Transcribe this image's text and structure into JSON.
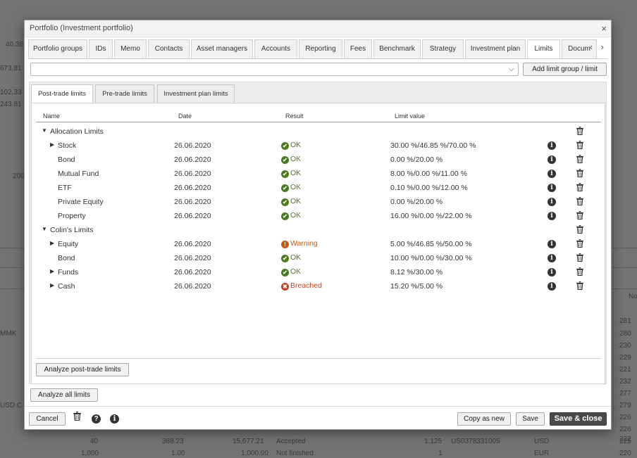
{
  "background": {
    "left_labels": [
      "40.36",
      "673.81",
      "102.33",
      "243.81",
      "200",
      "MMK",
      "USD C"
    ],
    "right_labels": [
      "No",
      "281",
      "280",
      "230",
      "229",
      "221",
      "232",
      "277",
      "279",
      "226",
      "226",
      "222",
      "225",
      "220",
      "221"
    ],
    "bottom_rows": [
      [
        "40",
        "388.23",
        "15,677.21",
        "Accepted",
        "1.125",
        "US0378331005",
        "USD"
      ],
      [
        "1,000",
        "1.00",
        "1,000.00",
        "Not finished",
        "1",
        "",
        "EUR"
      ]
    ]
  },
  "modal": {
    "title": "Portfolio (Investment portfolio)",
    "close_glyph": "×"
  },
  "tabs": [
    {
      "label": "Portfolio groups"
    },
    {
      "label": "IDs"
    },
    {
      "label": "Memo"
    },
    {
      "label": "Contacts"
    },
    {
      "label": "Asset managers"
    },
    {
      "label": "Accounts"
    },
    {
      "label": "Reporting"
    },
    {
      "label": "Fees"
    },
    {
      "label": "Benchmark"
    },
    {
      "label": "Strategy"
    },
    {
      "label": "Investment plan"
    },
    {
      "label": "Limits"
    },
    {
      "label": "Docum"
    }
  ],
  "active_tab": "Limits",
  "tab_arrows": "‹ ›",
  "group_select": {
    "value": "",
    "chevron": "⌵"
  },
  "add_limit_button": "Add limit group / limit",
  "subtabs": [
    {
      "label": "Post-trade limits"
    },
    {
      "label": "Pre-trade limits"
    },
    {
      "label": "Investment plan limits"
    }
  ],
  "columns": {
    "name": "Name",
    "date": "Date",
    "result": "Result",
    "limit_value": "Limit value"
  },
  "rows": [
    {
      "level": 0,
      "expand": "▼",
      "name": "Allocation Limits",
      "date": "",
      "result": "",
      "status": "",
      "icon": "",
      "limit": "",
      "info": false
    },
    {
      "level": 1,
      "expand": "▶",
      "name": "Stock",
      "date": "26.06.2020",
      "result": "OK",
      "status": "ok",
      "icon": "✔",
      "limit": "30.00 %/46.85 %/70.00 %",
      "info": true
    },
    {
      "level": 1,
      "expand": "",
      "name": "Bond",
      "date": "26.06.2020",
      "result": "OK",
      "status": "ok",
      "icon": "✔",
      "limit": "0.00 %/20.00 %",
      "info": true
    },
    {
      "level": 1,
      "expand": "",
      "name": "Mutual Fund",
      "date": "26.06.2020",
      "result": "OK",
      "status": "ok",
      "icon": "✔",
      "limit": "8.00 %/0.00 %/11.00 %",
      "info": true
    },
    {
      "level": 1,
      "expand": "",
      "name": "ETF",
      "date": "26.06.2020",
      "result": "OK",
      "status": "ok",
      "icon": "✔",
      "limit": "0.10 %/0.00 %/12.00 %",
      "info": true
    },
    {
      "level": 1,
      "expand": "",
      "name": "Private Equity",
      "date": "26.06.2020",
      "result": "OK",
      "status": "ok",
      "icon": "✔",
      "limit": "0.00 %/20.00 %",
      "info": true
    },
    {
      "level": 1,
      "expand": "",
      "name": "Property",
      "date": "26.06.2020",
      "result": "OK",
      "status": "ok",
      "icon": "✔",
      "limit": "16.00 %/0.00 %/22.00 %",
      "info": true
    },
    {
      "level": 0,
      "expand": "▼",
      "name": "Colin's Limits",
      "date": "",
      "result": "",
      "status": "",
      "icon": "",
      "limit": "",
      "info": false
    },
    {
      "level": 1,
      "expand": "▶",
      "name": "Equity",
      "date": "26.06.2020",
      "result": "Warning",
      "status": "warn",
      "icon": "!",
      "limit": "5.00 %/46.85 %/50.00 %",
      "info": true
    },
    {
      "level": 1,
      "expand": "",
      "name": "Bond",
      "date": "26.06.2020",
      "result": "OK",
      "status": "ok",
      "icon": "✔",
      "limit": "10.00 %/0.00 %/30.00 %",
      "info": true
    },
    {
      "level": 1,
      "expand": "▶",
      "name": "Funds",
      "date": "26.06.2020",
      "result": "OK",
      "status": "ok",
      "icon": "✔",
      "limit": "8.12 %/30.00 %",
      "info": true
    },
    {
      "level": 1,
      "expand": "▶",
      "name": "Cash",
      "date": "26.06.2020",
      "result": "Breached",
      "status": "breach",
      "icon": "✖",
      "limit": "15.20 %/5.00 %",
      "info": true
    }
  ],
  "analyze_post_trade_button": "Analyze post-trade limits",
  "analyze_all_button": "Analyze all limits",
  "footer": {
    "cancel": "Cancel",
    "copy_as_new": "Copy as new",
    "save": "Save",
    "save_close": "Save & close",
    "icons": [
      "trash-icon",
      "help-icon",
      "info-icon"
    ]
  },
  "colors": {
    "ok": "#4a7a1d",
    "warning": "#c45a10",
    "breached": "#c43d1d",
    "primary_button": "#4a4a4a"
  }
}
